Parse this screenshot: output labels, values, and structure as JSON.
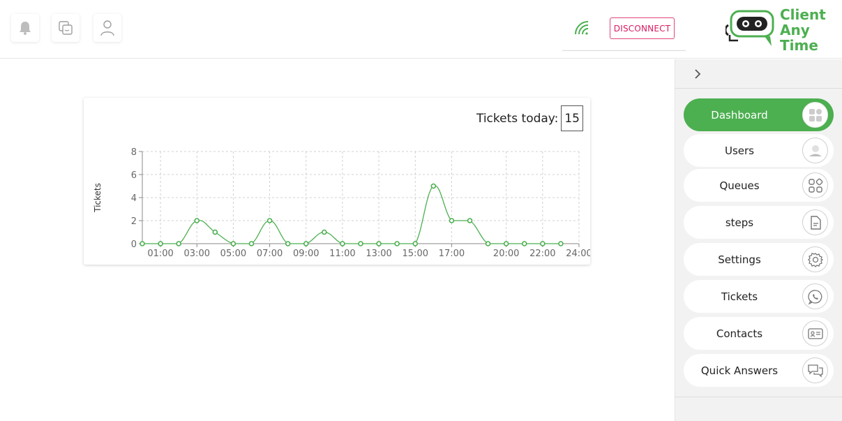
{
  "header": {
    "notification_icon": "bell-icon",
    "chat_icon": "chat-windows-icon",
    "user_icon": "user-icon",
    "connection_icon": "wifi-icon",
    "disconnect_label": "DISCONNECT",
    "disconnect_color": "#d81b60"
  },
  "logo": {
    "line1": "Client",
    "line2": "Any",
    "line3": "Time",
    "color": "#4caf50"
  },
  "sidebar": {
    "collapse_icon": "chevron-right-icon",
    "items": [
      {
        "label": "Dashboard",
        "icon": "dashboard-icon",
        "active": true
      },
      {
        "label": "Users",
        "icon": "user-icon",
        "active": false
      },
      {
        "label": "Queues",
        "icon": "grid-icon",
        "active": false
      },
      {
        "label": "steps",
        "icon": "document-icon",
        "active": false
      },
      {
        "label": "Settings",
        "icon": "gear-icon",
        "active": false
      },
      {
        "label": "Tickets",
        "icon": "phone-chat-icon",
        "active": false
      },
      {
        "label": "Contacts",
        "icon": "contact-card-icon",
        "active": false
      },
      {
        "label": "Quick Answers",
        "icon": "chat-bubbles-icon",
        "active": false
      }
    ],
    "accent": "#4caf50"
  },
  "dashboard": {
    "tickets_today_label": "Tickets today:",
    "tickets_today_value": "15"
  },
  "chart_data": {
    "type": "line",
    "title": "",
    "xlabel": "",
    "ylabel": "Tickets",
    "x": [
      "00:00",
      "01:00",
      "02:00",
      "03:00",
      "04:00",
      "05:00",
      "06:00",
      "07:00",
      "08:00",
      "09:00",
      "10:00",
      "11:00",
      "12:00",
      "13:00",
      "14:00",
      "15:00",
      "16:00",
      "17:00",
      "18:00",
      "19:00",
      "20:00",
      "21:00",
      "22:00",
      "23:00",
      "24:00"
    ],
    "tick_labels": [
      "01:00",
      "03:00",
      "05:00",
      "07:00",
      "09:00",
      "11:00",
      "13:00",
      "15:00",
      "17:00",
      "20:00",
      "22:00",
      "24:00"
    ],
    "y_ticks": [
      0,
      2,
      4,
      6,
      8
    ],
    "series": [
      {
        "values": [
          0,
          0,
          0,
          2,
          1,
          0,
          0,
          2,
          0,
          0,
          1,
          0,
          0,
          0,
          0,
          0,
          5,
          2,
          2,
          0,
          0,
          0,
          0,
          0
        ],
        "color": "#4caf50"
      }
    ],
    "ylim": [
      0,
      8
    ],
    "grid": true
  }
}
